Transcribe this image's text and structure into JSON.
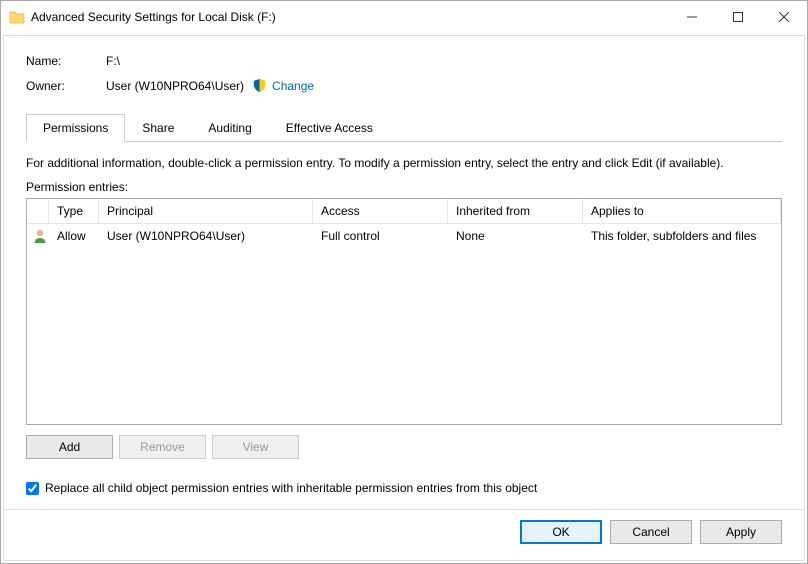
{
  "title": "Advanced Security Settings for Local Disk (F:)",
  "fields": {
    "name_label": "Name:",
    "name_value": "F:\\",
    "owner_label": "Owner:",
    "owner_value": "User (W10NPRO64\\User)",
    "change_link": "Change"
  },
  "tabs": {
    "permissions": "Permissions",
    "share": "Share",
    "auditing": "Auditing",
    "effective": "Effective Access"
  },
  "info_text": "For additional information, double-click a permission entry. To modify a permission entry, select the entry and click Edit (if available).",
  "entries_label": "Permission entries:",
  "columns": {
    "type": "Type",
    "principal": "Principal",
    "access": "Access",
    "inherited": "Inherited from",
    "applies": "Applies to"
  },
  "entries": [
    {
      "type": "Allow",
      "principal": "User (W10NPRO64\\User)",
      "access": "Full control",
      "inherited": "None",
      "applies": "This folder, subfolders and files"
    }
  ],
  "buttons": {
    "add": "Add",
    "remove": "Remove",
    "view": "View"
  },
  "checkbox_label": "Replace all child object permission entries with inheritable permission entries from this object",
  "dialog_buttons": {
    "ok": "OK",
    "cancel": "Cancel",
    "apply": "Apply"
  }
}
